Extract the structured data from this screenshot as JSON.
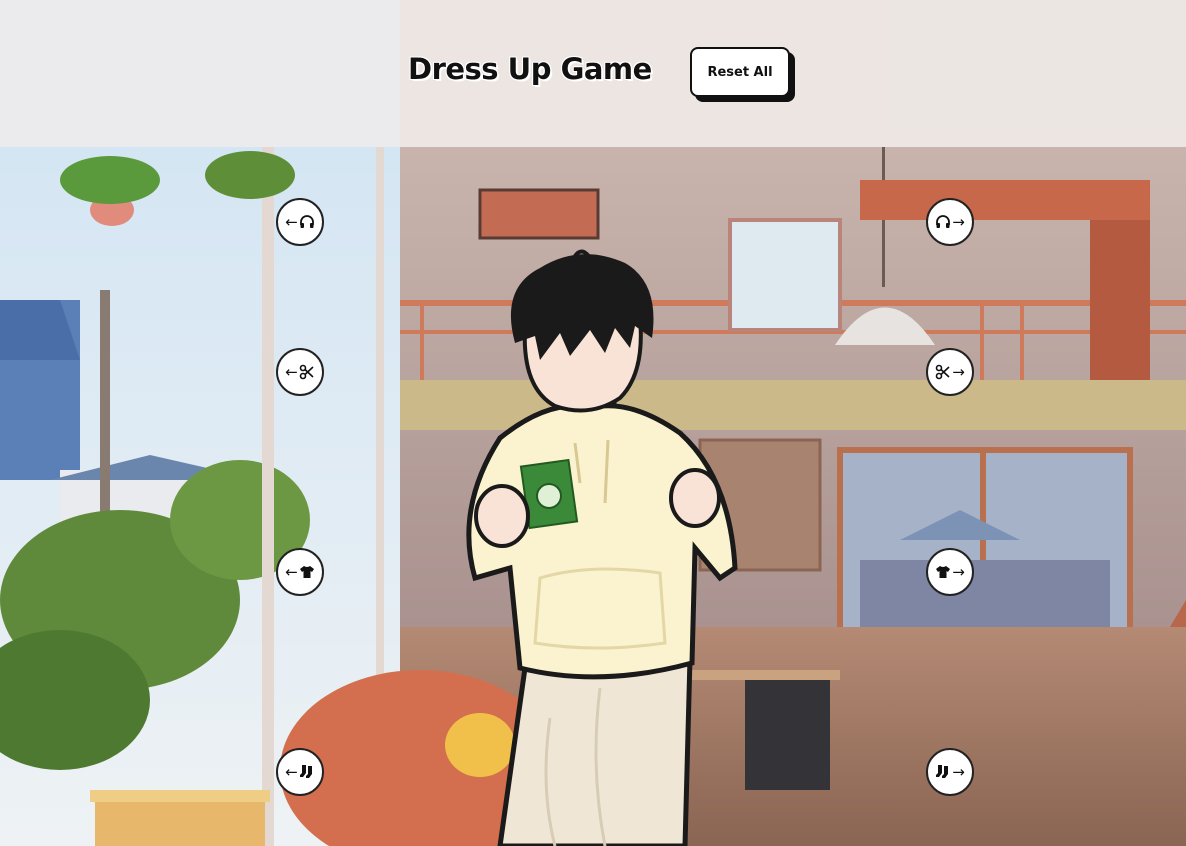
{
  "game": {
    "title": "Dress Up Game",
    "reset_label": "Reset All"
  },
  "controls": {
    "arrow_left": "←",
    "arrow_right": "→",
    "rows": [
      {
        "category": "accessory",
        "icon": "headphones-icon"
      },
      {
        "category": "hair",
        "icon": "scissors-icon"
      },
      {
        "category": "top",
        "icon": "tshirt-icon"
      },
      {
        "category": "bottom",
        "icon": "socks-icon"
      }
    ]
  },
  "character": {
    "hoodie_color": "#fbf3cf",
    "pants_color": "#efe6d6",
    "hair_color": "#1a1a1a",
    "patch_color": "#3b8a3a"
  }
}
